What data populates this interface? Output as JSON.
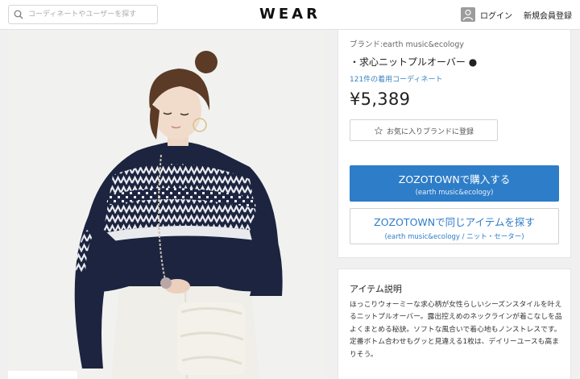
{
  "header": {
    "search_placeholder": "コーディネートやユーザーを探す",
    "logo": "WEAR",
    "login": "ログイン",
    "register": "新規会員登録"
  },
  "item": {
    "brand": "ブランド:earth music&ecology",
    "name": "・求心ニットプルオーバー ●",
    "coordinate_count": "121件の着用コーディネート",
    "price": "¥5,389",
    "favorite_brand_button": "お気に入りブランドに登録",
    "buy_button": {
      "label": "ZOZOTOWNで購入する",
      "sub": "(earth music&ecology)"
    },
    "same_item_button": {
      "label": "ZOZOTOWNで同じアイテムを探す",
      "sub": "(earth music&ecology / ニット・セーター)"
    }
  },
  "description": {
    "title": "アイテム説明",
    "text": "ほっこりウォーミーな求心柄が女性らしいシーズンスタイルを叶えるニットプルオーバー。露出控えめのネックラインが着こなしを品よくまとめる秘訣。ソフトな風合いで着心地もノンストレスです。定番ボトム合わせもグッと見違える1枚は、デイリーユースも高まりそう。"
  },
  "colors": {
    "accent": "#2e7dc8",
    "sweater": "#1c2440",
    "link": "#3a83c2"
  }
}
